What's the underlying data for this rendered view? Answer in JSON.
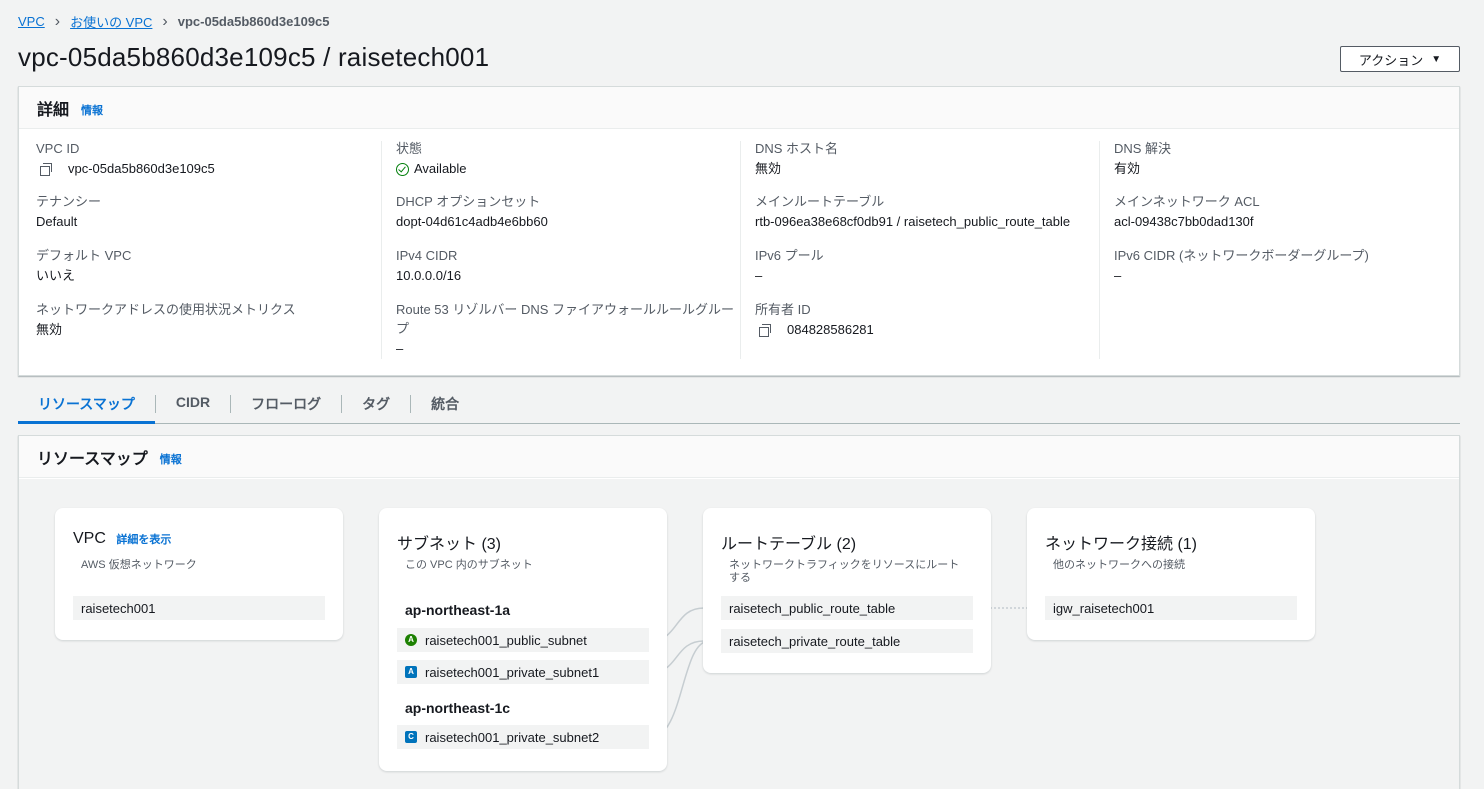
{
  "breadcrumb": {
    "items": [
      "VPC",
      "お使いの VPC"
    ],
    "current": "vpc-05da5b860d3e109c5"
  },
  "page": {
    "title": "vpc-05da5b860d3e109c5 / raisetech001",
    "action_label": "アクション"
  },
  "details": {
    "header": "詳細",
    "info": "情報",
    "fields": {
      "vpc_id": {
        "label": "VPC ID",
        "value": "vpc-05da5b860d3e109c5"
      },
      "state": {
        "label": "状態",
        "value": "Available"
      },
      "dns_hostnames": {
        "label": "DNS ホスト名",
        "value": "無効"
      },
      "dns_resolution": {
        "label": "DNS 解決",
        "value": "有効"
      },
      "tenancy": {
        "label": "テナンシー",
        "value": "Default"
      },
      "dhcp": {
        "label": "DHCP オプションセット",
        "value": "dopt-04d61c4adb4e6bb60"
      },
      "main_route_table": {
        "label": "メインルートテーブル",
        "value": "rtb-096ea38e68cf0db91 / raisetech_public_route_table"
      },
      "main_acl": {
        "label": "メインネットワーク ACL",
        "value": "acl-09438c7bb0dad130f"
      },
      "default_vpc": {
        "label": "デフォルト VPC",
        "value": "いいえ"
      },
      "ipv4_cidr": {
        "label": "IPv4 CIDR",
        "value": "10.0.0.0/16"
      },
      "ipv6_pool": {
        "label": "IPv6 プール",
        "value": "–"
      },
      "ipv6_cidr": {
        "label": "IPv6 CIDR (ネットワークボーダーグループ)",
        "value": "–"
      },
      "net_metrics": {
        "label": "ネットワークアドレスの使用状況メトリクス",
        "value": "無効"
      },
      "route53": {
        "label_line1": "Route 53 リゾルバー DNS ファイアウォールルールグルー",
        "label_line2": "プ",
        "value": "–"
      },
      "owner_id": {
        "label": "所有者 ID",
        "value": "084828586281"
      }
    }
  },
  "tabs": [
    "リソースマップ",
    "CIDR",
    "フローログ",
    "タグ",
    "統合"
  ],
  "resource_map": {
    "header": "リソースマップ",
    "info": "情報",
    "vpc_card": {
      "title": "VPC",
      "link": "詳細を表示",
      "subtitle": "AWS 仮想ネットワーク",
      "node": "raisetech001"
    },
    "subnet_card": {
      "title": "サブネット (3)",
      "subtitle": "この VPC 内のサブネット",
      "az1": "ap-northeast-1a",
      "az2": "ap-northeast-1c",
      "subnets": [
        {
          "icon": "A",
          "name": "raisetech001_public_subnet"
        },
        {
          "icon": "A",
          "name": "raisetech001_private_subnet1"
        },
        {
          "icon": "C",
          "name": "raisetech001_private_subnet2"
        }
      ]
    },
    "route_card": {
      "title": "ルートテーブル (2)",
      "subtitle_line1": "ネットワークトラフィックをリソースにルート",
      "subtitle_line2": "する",
      "tables": [
        "raisetech_public_route_table",
        "raisetech_private_route_table"
      ]
    },
    "network_card": {
      "title": "ネットワーク接続 (1)",
      "subtitle": "他のネットワークへの接続",
      "node": "igw_raisetech001"
    }
  }
}
